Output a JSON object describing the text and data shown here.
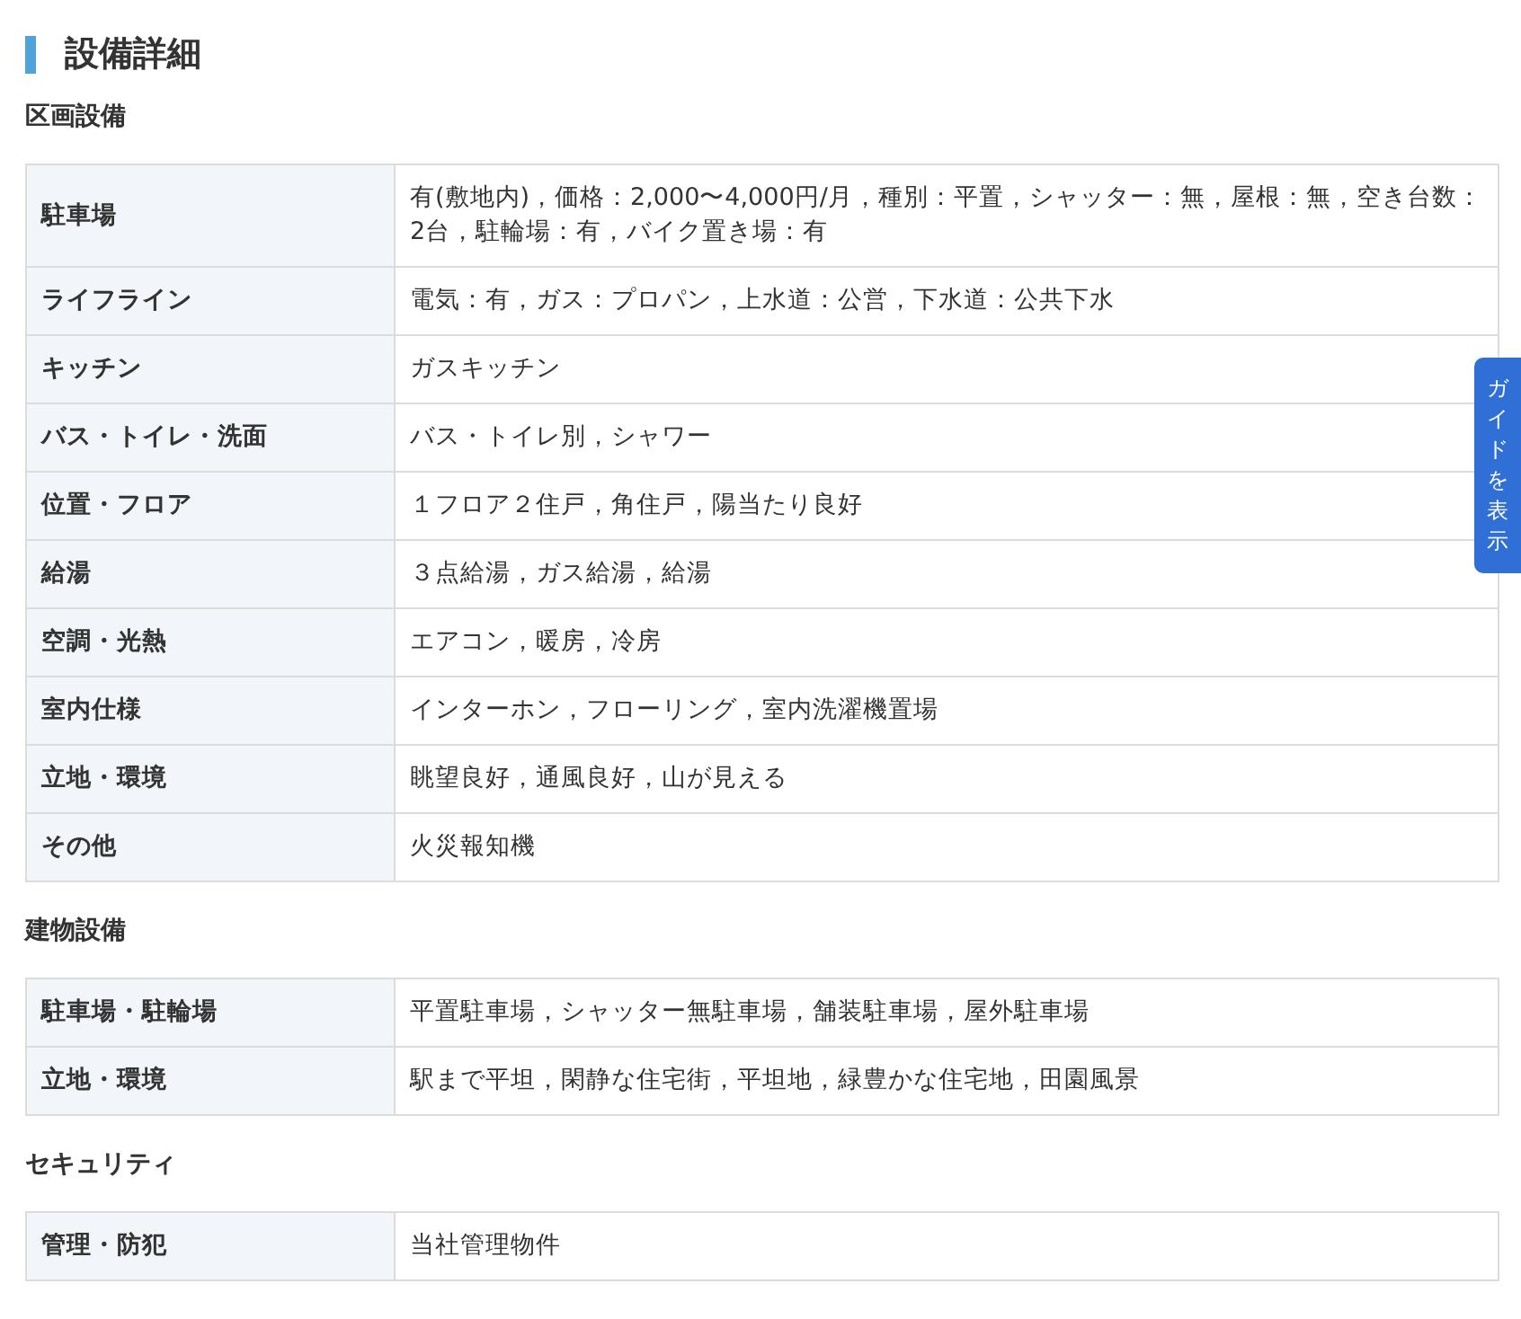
{
  "title": "設備詳細",
  "sections": [
    {
      "heading": "区画設備",
      "rows": [
        {
          "label": "駐車場",
          "value": "有(敷地内)，価格：2,000〜4,000円/月，種別：平置，シャッター：無，屋根：無，空き台数：2台，駐輪場：有，バイク置き場：有"
        },
        {
          "label": "ライフライン",
          "value": "電気：有，ガス：プロパン，上水道：公営，下水道：公共下水"
        },
        {
          "label": "キッチン",
          "value": "ガスキッチン"
        },
        {
          "label": "バス・トイレ・洗面",
          "value": "バス・トイレ別，シャワー"
        },
        {
          "label": "位置・フロア",
          "value": "１フロア２住戸，角住戸，陽当たり良好"
        },
        {
          "label": "給湯",
          "value": "３点給湯，ガス給湯，給湯"
        },
        {
          "label": "空調・光熱",
          "value": "エアコン，暖房，冷房"
        },
        {
          "label": "室内仕様",
          "value": "インターホン，フローリング，室内洗濯機置場"
        },
        {
          "label": "立地・環境",
          "value": "眺望良好，通風良好，山が見える"
        },
        {
          "label": "その他",
          "value": "火災報知機"
        }
      ]
    },
    {
      "heading": "建物設備",
      "rows": [
        {
          "label": "駐車場・駐輪場",
          "value": "平置駐車場，シャッター無駐車場，舗装駐車場，屋外駐車場"
        },
        {
          "label": "立地・環境",
          "value": "駅まで平坦，閑静な住宅街，平坦地，緑豊かな住宅地，田園風景"
        }
      ]
    },
    {
      "heading": "セキュリティ",
      "rows": [
        {
          "label": "管理・防犯",
          "value": "当社管理物件"
        }
      ]
    }
  ],
  "guide_tab": "ガイドを表示"
}
